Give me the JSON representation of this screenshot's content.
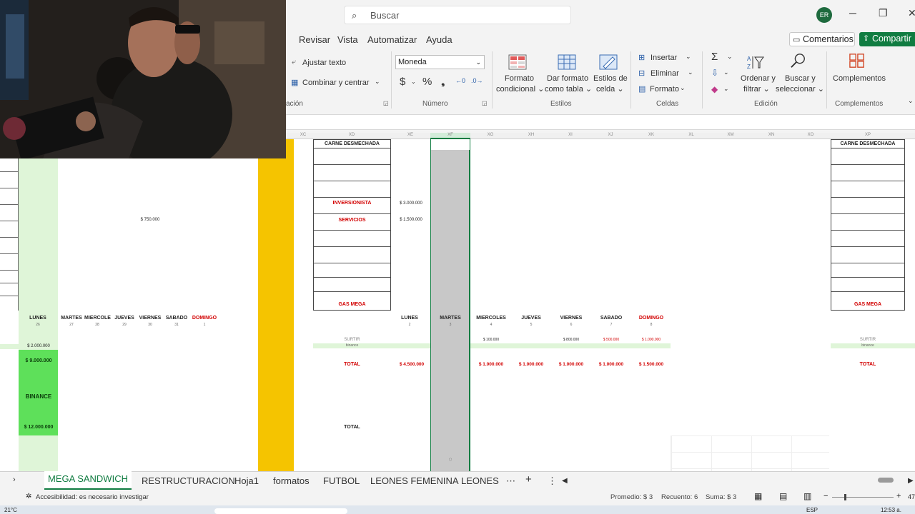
{
  "titlebar": {
    "search_placeholder": "Buscar",
    "avatar_initials": "ER",
    "minimize": "─",
    "restore": "❐",
    "close": "✕"
  },
  "menu": {
    "items": [
      "Revisar",
      "Vista",
      "Automatizar",
      "Ayuda"
    ],
    "comments": "Comentarios",
    "share": "Compartir"
  },
  "ribbon": {
    "wrap_text": "Ajustar texto",
    "merge_center": "Combinar y centrar",
    "alignment_group": "ación",
    "number_format": "Moneda",
    "number_group": "Número",
    "cond_format": [
      "Formato",
      "condicional ⌄"
    ],
    "format_table": [
      "Dar formato",
      "como tabla ⌄"
    ],
    "cell_styles": [
      "Estilos de",
      "celda ⌄"
    ],
    "styles_group": "Estilos",
    "insert": "Insertar",
    "delete": "Eliminar",
    "format": "Formato",
    "cells_group": "Celdas",
    "sort_filter": [
      "Ordenar y",
      "filtrar ⌄"
    ],
    "find_select": [
      "Buscar y",
      "seleccionar ⌄"
    ],
    "editing_group": "Edición",
    "addins": "Complementos",
    "addins_group": "Complementos"
  },
  "columns": [
    "XC",
    "XD",
    "XE",
    "XF",
    "XG",
    "XH",
    "XI",
    "XJ",
    "XK",
    "XL",
    "XM",
    "XN",
    "XO",
    "XP"
  ],
  "sheet": {
    "left": {
      "amount_750": "$ 750.000",
      "days": [
        [
          "LUNES",
          "26"
        ],
        [
          "MARTES",
          "27"
        ],
        [
          "MIERCOLE",
          "28"
        ],
        [
          "JUEVES",
          "29"
        ],
        [
          "VIERNES",
          "30"
        ],
        [
          "SABADO",
          "31"
        ],
        [
          "DOMINGO",
          "1"
        ]
      ],
      "amount_2m": "$ 2.000.000",
      "amount_9m": "$ 9.000.000",
      "binance": "BINANCE",
      "amount_12m": "$ 12.000.000"
    },
    "mid": {
      "header": "CARNE DESMECHADA",
      "inversionista": "INVERSIONISTA",
      "servicios": "SERVICIOS",
      "gas_mega": "GAS MEGA",
      "inv_amount": "$ 3.000.000",
      "serv_amount": "$ 1.500.000",
      "days": [
        [
          "LUNES",
          "2"
        ],
        [
          "MARTES",
          "3"
        ],
        [
          "MIERCOLES",
          "4"
        ],
        [
          "JUEVES",
          "5"
        ],
        [
          "VIERNES",
          "6"
        ],
        [
          "SABADO",
          "7"
        ],
        [
          "DOMINGO",
          "8"
        ]
      ],
      "surtir": "SURTIR",
      "binance": "binance",
      "surtir_amounts": [
        "$ 100.000",
        "$ 800.000",
        "$ 500.000",
        "$ 1.000.000"
      ],
      "total": "TOTAL",
      "total_amounts": [
        "$ 4.500.000",
        "$ 1.000.000",
        "$ 1.000.000",
        "$ 1.000.000",
        "$ 1.000.000",
        "$ 1.500.000"
      ],
      "total2": "TOTAL"
    },
    "right": {
      "header": "CARNE DESMECHADA",
      "gas_mega": "GAS MEGA",
      "surtir": "SURTIR",
      "binance": "binance",
      "total": "TOTAL"
    }
  },
  "tabs": {
    "active": "MEGA SANDWICH",
    "others": [
      "RESTRUCTURACION",
      "Hoja1",
      "formatos",
      "FUTBOL",
      "LEONES FEMENINA",
      "LEONES su"
    ],
    "more": "⋯",
    "add": "+",
    "menu": "⋮"
  },
  "status": {
    "accessibility": "Accesibilidad: es necesario investigar",
    "average": "Promedio: $ 3",
    "count": "Recuento: 6",
    "sum": "Suma: $ 3",
    "zoom_minus": "−",
    "zoom_plus": "+",
    "zoom_value": "47",
    "temp": "21°C",
    "time": "12:53 a.",
    "lang": "ESP"
  },
  "colors": {
    "excel_green": "#107c41",
    "light_green": "#dff5d8",
    "bright_green": "#5ee05a",
    "yellow": "#f5c400",
    "gray_col": "#c8c8c8",
    "red_text": "#d20000"
  }
}
